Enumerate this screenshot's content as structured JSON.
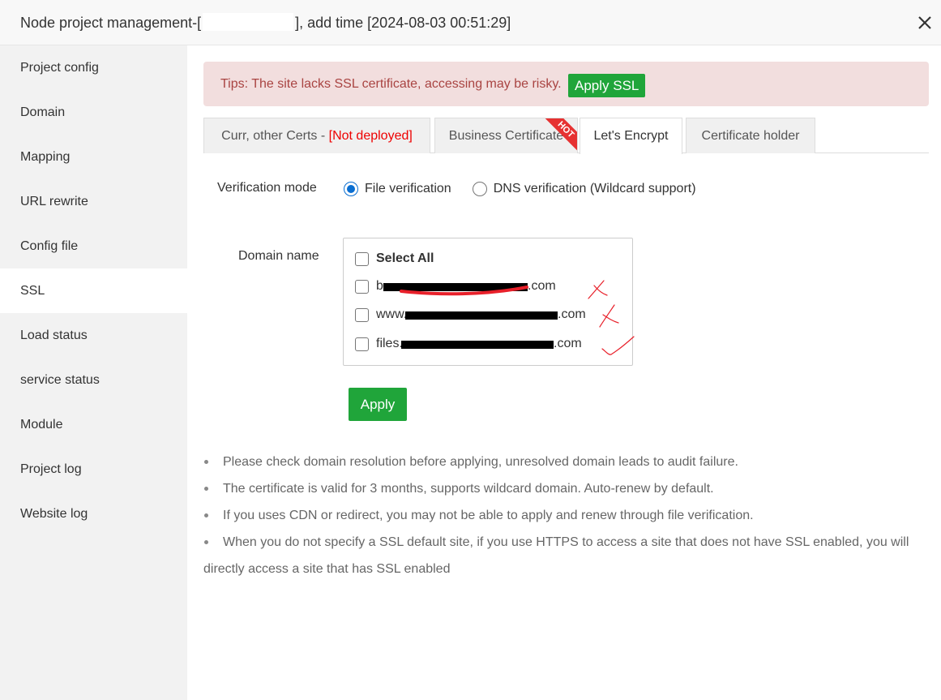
{
  "window": {
    "title_prefix": "Node project management-[",
    "title_suffix": "], add time [2024-08-03 00:51:29]",
    "close_glyph": "×"
  },
  "sidebar": {
    "items": [
      {
        "label": "Project config"
      },
      {
        "label": "Domain"
      },
      {
        "label": "Mapping"
      },
      {
        "label": "URL rewrite"
      },
      {
        "label": "Config file"
      },
      {
        "label": "SSL",
        "active": true
      },
      {
        "label": "Load status"
      },
      {
        "label": "service status"
      },
      {
        "label": "Module"
      },
      {
        "label": "Project log"
      },
      {
        "label": "Website log"
      }
    ]
  },
  "tips": {
    "text": "Tips: The site lacks SSL certificate, accessing may be risky.",
    "button": "Apply SSL"
  },
  "tabs": [
    {
      "label": "Curr, other Certs - ",
      "status": "[Not deployed]"
    },
    {
      "label": "Business Certificate",
      "badge": "HOT"
    },
    {
      "label": "Let's Encrypt",
      "active": true
    },
    {
      "label": "Certificate holder"
    }
  ],
  "form": {
    "verification_label": "Verification mode",
    "mode_options": [
      {
        "label": "File verification",
        "checked": true
      },
      {
        "label": "DNS verification (Wildcard support)",
        "checked": false
      }
    ],
    "domain_label": "Domain name",
    "select_all": "Select All",
    "domains": [
      {
        "prefix": "b",
        "suffix": ".com"
      },
      {
        "prefix": "www.",
        "suffix": ".com"
      },
      {
        "prefix": "files.",
        "suffix": ".com"
      }
    ],
    "apply_button": "Apply"
  },
  "notes": [
    "Please check domain resolution before applying, unresolved domain leads to audit failure.",
    "The certificate is valid for 3 months, supports wildcard domain. Auto-renew by default.",
    "If you uses CDN or redirect, you may not be able to apply and renew through file verification.",
    "When you do not specify a SSL default site, if you use HTTPS to access a site that does not have SSL enabled, you will",
    "directly access a site that has SSL enabled"
  ],
  "colors": {
    "accent_green": "#20a53a",
    "tips_bg": "#f2dede",
    "tips_text": "#a94442",
    "radio_blue": "#0a6ed1",
    "warning_red": "#e00000"
  }
}
